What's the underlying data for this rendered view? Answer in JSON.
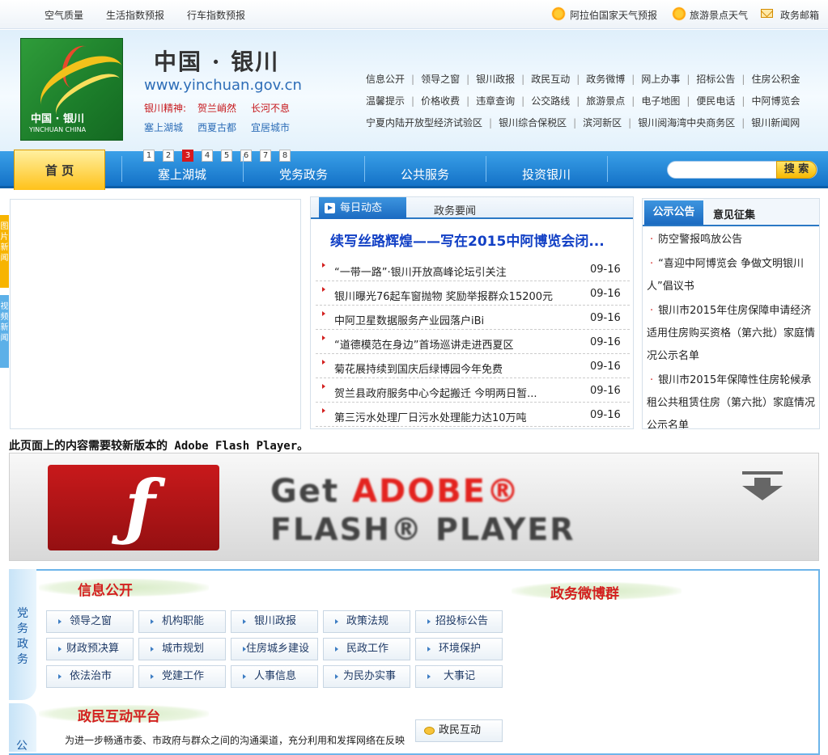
{
  "topbar": {
    "links": [
      "空气质量",
      "生活指数预报",
      "行车指数预报"
    ],
    "right_links": [
      "阿拉伯国家天气预报",
      "旅游景点天气",
      "政务邮箱"
    ]
  },
  "header": {
    "title": "中国 · 银川",
    "url": "www.yinchuan.gov.cn",
    "logo_text": "中国 · 银川",
    "logo_sub": "YINCHUAN CHINA",
    "spirit_label": "银川精神:",
    "spirit": [
      "贺兰峭然",
      "长河不息"
    ],
    "tags": [
      "塞上湖城",
      "西夏古都",
      "宜居城市"
    ],
    "nav_rows": [
      [
        "信息公开",
        "领导之窗",
        "银川政报",
        "政民互动",
        "政务微博",
        "网上办事",
        "招标公告",
        "住房公积金"
      ],
      [
        "温馨提示",
        "价格收费",
        "违章查询",
        "公交路线",
        "旅游景点",
        "电子地图",
        "便民电话",
        "中阿博览会"
      ],
      [
        "宁夏内陆开放型经济试验区",
        "银川综合保税区",
        "滨河新区",
        "银川阅海湾中央商务区",
        "银川新闻网"
      ]
    ]
  },
  "mainnav": {
    "home": "首 页",
    "items": [
      "塞上湖城",
      "党务政务",
      "公共服务",
      "投资银川"
    ],
    "pages": [
      "1",
      "2",
      "3",
      "4",
      "5",
      "6",
      "7",
      "8"
    ],
    "search_placeholder": "",
    "search_button": "搜 索"
  },
  "side_tabs": [
    "图片新闻",
    "视频新闻"
  ],
  "news": {
    "tabs": [
      "每日动态",
      "政务要闻"
    ],
    "headline": "续写丝路辉煌——写在2015中阿博览会闭...",
    "items": [
      {
        "title": "“一带一路”·银川开放高峰论坛引关注",
        "date": "09-16"
      },
      {
        "title": "银川曝光76起车窗抛物 奖励举报群众15200元",
        "date": "09-16"
      },
      {
        "title": "中阿卫星数据服务产业园落户iBi",
        "date": "09-16"
      },
      {
        "title": "“道德模范在身边”首场巡讲走进西夏区",
        "date": "09-16"
      },
      {
        "title": "菊花展持续到国庆后绿博园今年免费",
        "date": "09-16"
      },
      {
        "title": "贺兰县政府服务中心今起搬迁 今明两日暂...",
        "date": "09-16"
      },
      {
        "title": "第三污水处理厂日污水处理能力达10万吨",
        "date": "09-16"
      }
    ]
  },
  "notice": {
    "tabs": [
      "公示公告",
      "意见征集"
    ],
    "items": [
      "防空警报鸣放公告",
      "“喜迎中阿博览会 争做文明银川人”倡议书",
      "银川市2015年住房保障申请经济适用住房购买资格（第六批）家庭情况公示名单",
      "银川市2015年保障性住房轮候承租公共租赁住房（第六批）家庭情况公示名单"
    ]
  },
  "flash": {
    "message": "此页面上的内容需要较新版本的 Adobe Flash Player。",
    "get": "Get",
    "adobe": "ADOBE®",
    "player": "FLASH® PLAYER"
  },
  "bottom": {
    "dangwu_label": "党务政务",
    "gong_label": "公",
    "info_title": "信息公开",
    "weibo_title": "政务微博群",
    "info_buttons": [
      [
        "领导之窗",
        "机构职能",
        "银川政报",
        "政策法规",
        "招投标公告"
      ],
      [
        "财政预决算",
        "城市规划",
        "住房城乡建设",
        "民政工作",
        "环境保护"
      ],
      [
        "依法治市",
        "党建工作",
        "人事信息",
        "为民办实事",
        "大事记"
      ]
    ],
    "interaction_title": "政民互动平台",
    "interaction_desc": "为进一步畅通市委、市政府与群众之间的沟通渠道，充分利用和发挥网络在反映",
    "interaction_button": "政民互动"
  }
}
